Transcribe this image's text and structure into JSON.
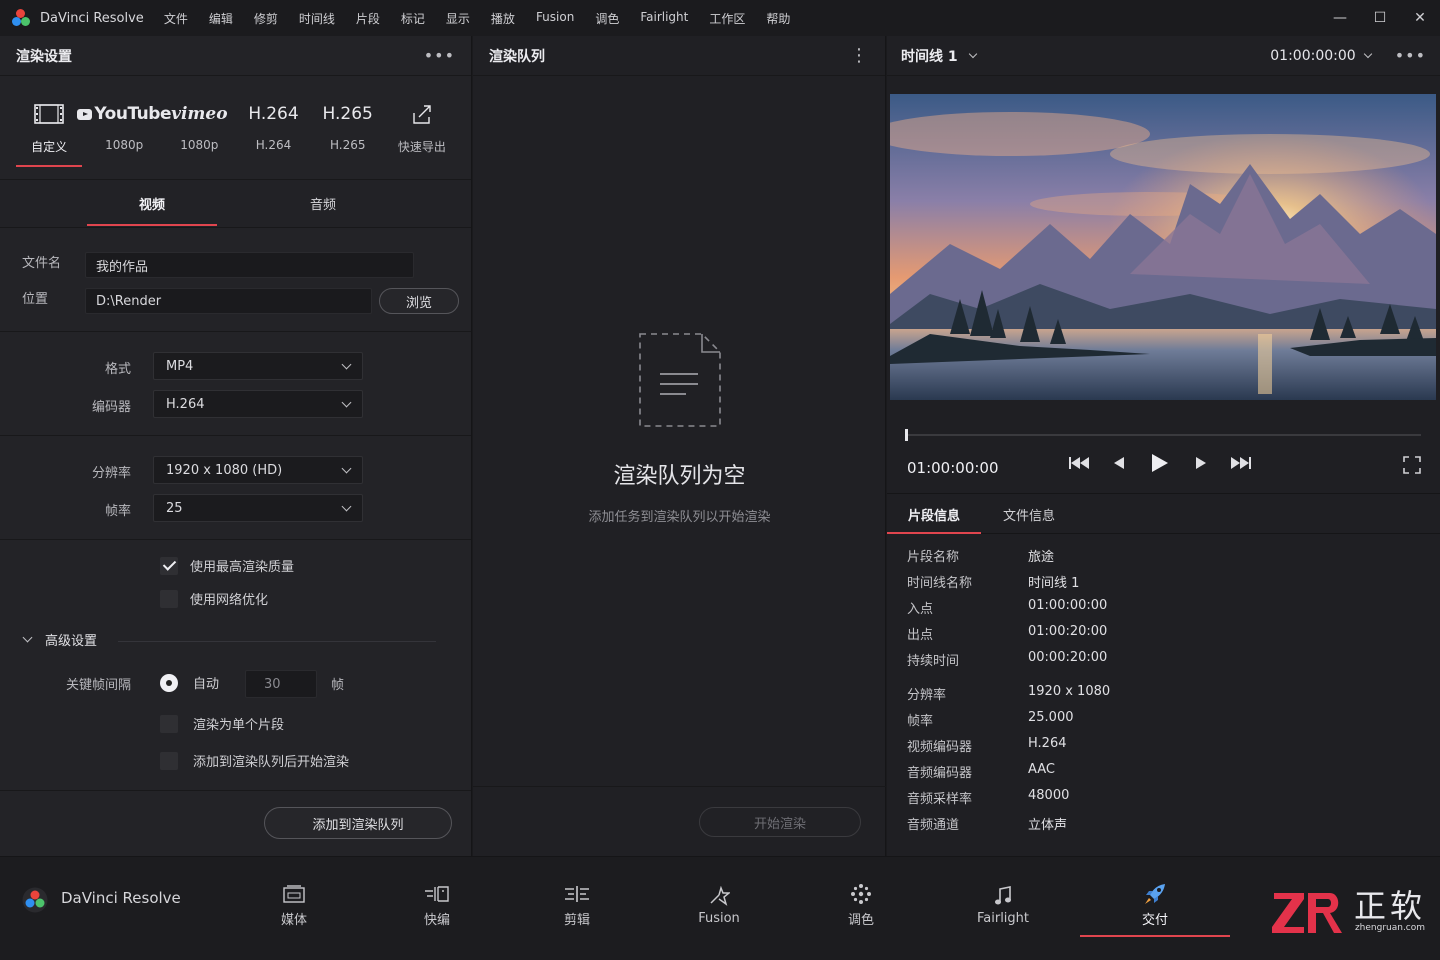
{
  "titlebar": {
    "app_name": "DaVinci Resolve",
    "menus": [
      "文件",
      "编辑",
      "修剪",
      "时间线",
      "片段",
      "标记",
      "显示",
      "播放",
      "Fusion",
      "调色",
      "Fairlight",
      "工作区",
      "帮助"
    ],
    "minimize": "—",
    "maximize": "☐",
    "close": "✕"
  },
  "left": {
    "title": "渲染设置",
    "menu": "•••",
    "presets": [
      {
        "icon": "film-icon",
        "label": "自定义",
        "active": true
      },
      {
        "icon": "youtube-icon",
        "icon_text": "YouTube",
        "label": "1080p"
      },
      {
        "icon": "vimeo-icon",
        "icon_text": "vimeo",
        "label": "1080p"
      },
      {
        "icon": "h264-icon",
        "icon_text": "H.264",
        "label": "H.264"
      },
      {
        "icon": "h265-icon",
        "icon_text": "H.265",
        "label": "H.265"
      },
      {
        "icon": "quick-export-icon",
        "label": "快速导出"
      }
    ],
    "tabs": {
      "video": "视频",
      "audio": "音频"
    },
    "file": {
      "name_label": "文件名",
      "name_value": "我的作品",
      "loc_label": "位置",
      "loc_value": "D:\\Render",
      "browse": "浏览"
    },
    "format": {
      "format_label": "格式",
      "format_value": "MP4",
      "codec_label": "编码器",
      "codec_value": "H.264"
    },
    "video": {
      "res_label": "分辨率",
      "res_value": "1920 x 1080 (HD)",
      "fps_label": "帧率",
      "fps_value": "25"
    },
    "checks": {
      "max_quality": "使用最高渲染质量",
      "web_opt": "使用网络优化"
    },
    "advanced": {
      "title": "高级设置",
      "keyframe_label": "关键帧间隔",
      "auto": "自动",
      "keyframe_value": "30",
      "frame_unit": "帧",
      "single_clip": "渲染为单个片段",
      "start_after_add": "添加到渲染队列后开始渲染"
    },
    "add_button": "添加到渲染队列"
  },
  "mid": {
    "title": "渲染队列",
    "menu": "⋮",
    "empty_title": "渲染队列为空",
    "empty_sub": "添加任务到渲染队列以开始渲染",
    "start_button": "开始渲染"
  },
  "right": {
    "timeline": "时间线 1",
    "timecode_top": "01:00:00:00",
    "menu": "•••",
    "progress": 0.0,
    "timecode": "01:00:00:00",
    "tabs": {
      "clip": "片段信息",
      "file": "文件信息"
    },
    "info": [
      {
        "k": "片段名称",
        "v": "旅途"
      },
      {
        "k": "时间线名称",
        "v": "时间线 1"
      },
      {
        "k": "入点",
        "v": "01:00:00:00"
      },
      {
        "k": "出点",
        "v": "01:00:20:00"
      },
      {
        "k": "持续时间",
        "v": "00:00:20:00"
      },
      {
        "k": "分辨率",
        "v": "1920 x 1080"
      },
      {
        "k": "帧率",
        "v": "25.000"
      },
      {
        "k": "视频编码器",
        "v": "H.264"
      },
      {
        "k": "音频编码器",
        "v": "AAC"
      },
      {
        "k": "音频采样率",
        "v": "48000"
      },
      {
        "k": "音频通道",
        "v": "立体声"
      }
    ]
  },
  "bottom": {
    "app_name": "DaVinci Resolve",
    "pages": [
      {
        "icon": "media-icon",
        "label": "媒体"
      },
      {
        "icon": "cut-icon",
        "label": "快编"
      },
      {
        "icon": "edit-icon",
        "label": "剪辑"
      },
      {
        "icon": "fusion-icon",
        "label": "Fusion"
      },
      {
        "icon": "color-icon",
        "label": "调色"
      },
      {
        "icon": "fairlight-icon",
        "label": "Fairlight"
      },
      {
        "icon": "deliver-icon",
        "label": "交付",
        "active": true
      }
    ],
    "watermark": {
      "logo": "ZR",
      "text": "正软",
      "domain": "zhengruan.com"
    }
  },
  "colors": {
    "accent": "#e0454e",
    "background": "#1a1a1d",
    "panel": "#232327"
  }
}
